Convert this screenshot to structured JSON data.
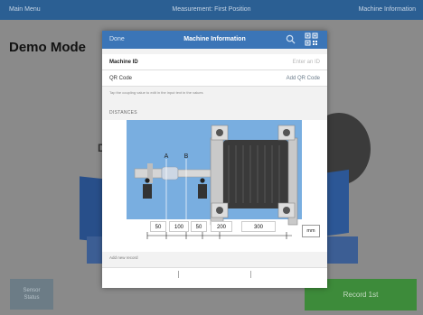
{
  "topbar": {
    "left": "Main Menu",
    "center": "Measurement: First Position",
    "right": "Machine Information"
  },
  "background": {
    "mode_title": "Demo Mode",
    "partial_letter": "D",
    "unit_button": [
      "Sensor",
      "Status"
    ],
    "record_button": "Record 1st"
  },
  "modal": {
    "done": "Done",
    "title": "Machine Information",
    "search_icon": "search-icon",
    "qr_icon": "qr-code-icon",
    "fields": [
      {
        "key": "Machine ID",
        "value": "Enter an ID"
      },
      {
        "key": "QR Code",
        "value": "Add QR Code"
      }
    ],
    "hint": "Tap the coupling value to edit in the input text in the values",
    "distances_label": "DISTANCES",
    "dimensions": [
      "50",
      "100",
      "50",
      "200",
      "300"
    ],
    "unit": "mm",
    "add_label": "Add new record"
  },
  "colors": {
    "topbar": "#2b5f93",
    "modal_header": "#3b75b7",
    "record_green": "#3d8b3a",
    "diagram_bg": "#79aee0"
  }
}
